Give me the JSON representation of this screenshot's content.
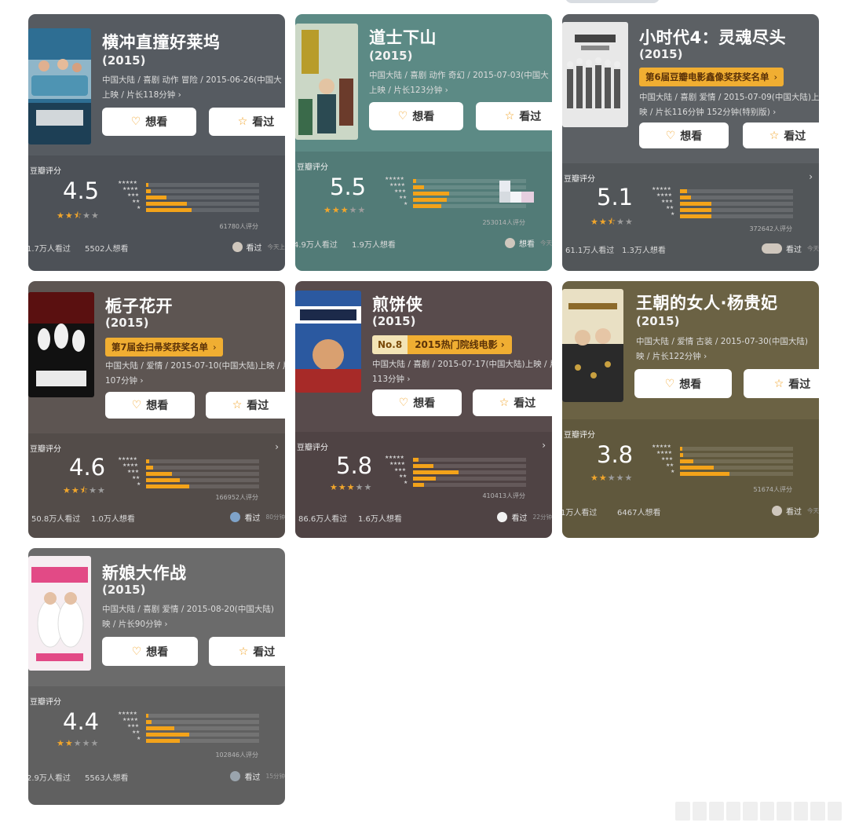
{
  "labels": {
    "want_button": "想看",
    "watched_button": "看过",
    "rating_label": "豆瓣评分"
  },
  "colors": {
    "star_on": "#f1a62c",
    "bar_fill": "#f3a31a",
    "award_bg": "#f0ae32"
  },
  "movies": [
    {
      "title": "横冲直撞好莱坞",
      "year": "(2015)",
      "meta_line1": "中国大陆 / 喜剧 动作 冒险 / 2015-06-26(中国大",
      "meta_line2": "上映 / 片长118分钟 ›",
      "score": "4.5",
      "stars": 2.5,
      "distribution": [
        0.02,
        0.04,
        0.18,
        0.36,
        0.4
      ],
      "rating_count": "61780人评分",
      "watched_stat": "1.7万人看过",
      "want_stat": "5502人想看",
      "friend_action": "看过",
      "friend_time": "今天上",
      "bg": "#565b61"
    },
    {
      "title": "道士下山",
      "year": "(2015)",
      "meta_line1": "中国大陆 / 喜剧 动作 奇幻 / 2015-07-03(中国大",
      "meta_line2": "上映 / 片长123分钟 ›",
      "score": "5.5",
      "stars": 3,
      "distribution": [
        0.03,
        0.1,
        0.32,
        0.3,
        0.25
      ],
      "rating_count": "253014人评分",
      "watched_stat": "4.9万人看过",
      "want_stat": "1.9万人想看",
      "friend_action": "想看",
      "friend_time": "今天",
      "bg": "#5c8a85"
    },
    {
      "title": "小时代4：灵魂尽头",
      "year": "(2015)",
      "award": "第6届豆瓣电影鑫像奖获奖名单",
      "meta_line1": "中国大陆 / 喜剧 爱情 / 2015-07-09(中国大陆)上",
      "meta_line2": "映 / 片长116分钟 152分钟(特别版) ›",
      "score": "5.1",
      "stars": 2.5,
      "distribution": [
        0.06,
        0.1,
        0.28,
        0.28,
        0.28
      ],
      "rating_count": "372642人评分",
      "watched_stat": "61.1万人看过",
      "want_stat": "1.3万人想看",
      "friend_action": "看过",
      "friend_time": "今天",
      "bg": "#5c6064"
    },
    {
      "title": "栀子花开",
      "year": "(2015)",
      "award": "第7届金扫帚奖获奖名单",
      "meta_line1": "中国大陆 / 爱情 / 2015-07-10(中国大陆)上映 / 片",
      "meta_line2": "107分钟 ›",
      "score": "4.6",
      "stars": 2.5,
      "distribution": [
        0.03,
        0.06,
        0.23,
        0.3,
        0.38
      ],
      "rating_count": "166952人评分",
      "watched_stat": "50.8万人看过",
      "want_stat": "1.0万人想看",
      "friend_action": "看过",
      "friend_time": "80分钟",
      "bg": "#5d5552"
    },
    {
      "title": "煎饼侠",
      "year": "(2015)",
      "rank_no": "No.8",
      "rank_list": "2015热门院线电影",
      "meta_line1": "中国大陆 / 喜剧 / 2015-07-17(中国大陆)上映 / 片",
      "meta_line2": "113分钟 ›",
      "score": "5.8",
      "stars": 3,
      "distribution": [
        0.05,
        0.18,
        0.4,
        0.2,
        0.1
      ],
      "rating_count": "410413人评分",
      "watched_stat": "86.6万人看过",
      "want_stat": "1.6万人想看",
      "friend_action": "看过",
      "friend_time": "22分钟",
      "bg": "#584b4c"
    },
    {
      "title": "王朝的女人·杨贵妃",
      "year": "(2015)",
      "meta_line1": "中国大陆 / 爱情 古装 / 2015-07-30(中国大陆)",
      "meta_line2": "映 / 片长122分钟 ›",
      "score": "3.8",
      "stars": 2,
      "distribution": [
        0.02,
        0.03,
        0.12,
        0.3,
        0.44
      ],
      "rating_count": "51674人评分",
      "watched_stat": "1万人看过",
      "want_stat": "6467人想看",
      "friend_action": "看过",
      "friend_time": "今天",
      "bg": "#6b6244"
    },
    {
      "title": "新娘大作战",
      "year": "(2015)",
      "meta_line1": "中国大陆 / 喜剧 爱情 / 2015-08-20(中国大陆)",
      "meta_line2": "映 / 片长90分钟 ›",
      "score": "4.4",
      "stars": 2,
      "distribution": [
        0.02,
        0.05,
        0.25,
        0.38,
        0.3
      ],
      "rating_count": "102846人评分",
      "watched_stat": "2.9万人看过",
      "want_stat": "5563人想看",
      "friend_action": "看过",
      "friend_time": "15分钟",
      "bg": "#6b6b6b"
    }
  ]
}
